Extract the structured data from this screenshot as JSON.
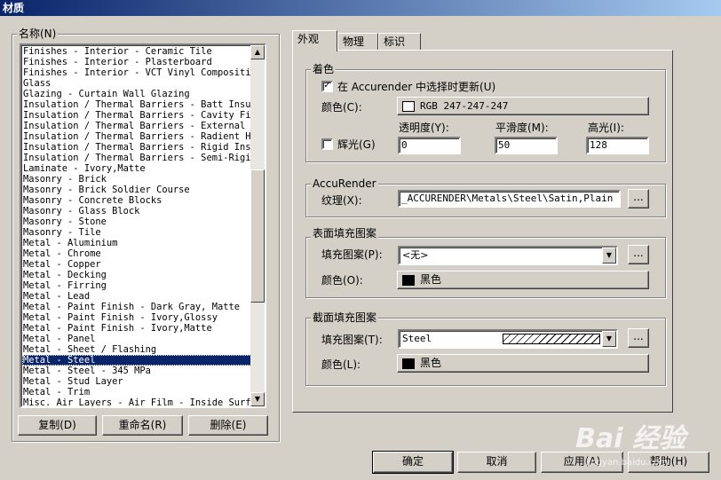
{
  "window": {
    "title": "材质"
  },
  "names_group": {
    "label": "名称(N)"
  },
  "materials": [
    "Finishes - Interior - Ceramic Tile",
    "Finishes - Interior - Plasterboard",
    "Finishes - Interior - VCT Vinyl Composition",
    "Glass",
    "Glazing - Curtain Wall Glazing",
    "Insulation / Thermal Barriers - Batt Insula",
    "Insulation / Thermal Barriers - Cavity Fill",
    "Insulation / Thermal Barriers - External Wa",
    "Insulation / Thermal Barriers - Radient Hea",
    "Insulation / Thermal Barriers - Rigid Insul",
    "Insulation / Thermal Barriers - Semi-Rigid I",
    "Laminate - Ivory,Matte",
    "Masonry - Brick",
    "Masonry - Brick Soldier Course",
    "Masonry - Concrete Blocks",
    "Masonry - Glass Block",
    "Masonry - Stone",
    "Masonry - Tile",
    "Metal - Aluminium",
    "Metal - Chrome",
    "Metal - Copper",
    "Metal - Decking",
    "Metal - Firring",
    "Metal - Lead",
    "Metal - Paint Finish - Dark Gray, Matte",
    "Metal - Paint Finish - Ivory,Glossy",
    "Metal - Paint Finish - Ivory,Matte",
    "Metal - Panel",
    "Metal - Sheet / Flashing",
    "Metal - Steel",
    "Metal - Steel - 345 MPa",
    "Metal - Stud Layer",
    "Metal - Trim",
    "Misc. Air Layers - Air Film - Inside Surfac"
  ],
  "selected_index": 29,
  "list_buttons": {
    "copy": "复制(D)",
    "rename": "重命名(R)",
    "delete": "删除(E)"
  },
  "tabs": [
    {
      "label": "外观"
    },
    {
      "label": "物理"
    },
    {
      "label": "标识"
    }
  ],
  "shading": {
    "group_label": "着色",
    "accurender_update_label": "在 Accurender 中选择时更新(U)",
    "accurender_update_checked": true,
    "color_label": "颜色(C):",
    "color_value": "RGB 247-247-247",
    "color_hex": "#f7f7f7",
    "glow_label": "辉光(G)",
    "glow_checked": false,
    "transparency_label": "透明度(Y):",
    "transparency_value": "0",
    "smoothness_label": "平滑度(M):",
    "smoothness_value": "50",
    "highlight_label": "高光(I):",
    "highlight_value": "128"
  },
  "accurender": {
    "group_label": "AccuRender",
    "texture_label": "纹理(X):",
    "texture_value": "_ACCURENDER\\Metals\\Steel\\Satin,Plain",
    "browse_label": "..."
  },
  "surface_pattern": {
    "group_label": "表面填充图案",
    "fill_label": "填充图案(P):",
    "fill_value": "<无>",
    "color_label": "颜色(O):",
    "color_value": "黑色",
    "color_hex": "#000000",
    "browse_label": "..."
  },
  "cut_pattern": {
    "group_label": "截面填充图案",
    "fill_label": "填充图案(T):",
    "fill_value": "Steel",
    "color_label": "颜色(L):",
    "color_value": "黑色",
    "color_hex": "#000000",
    "browse_label": "..."
  },
  "footer": {
    "ok": "确定",
    "cancel": "取消",
    "apply": "应用(A)",
    "help": "帮助(H)"
  },
  "watermark": {
    "text": "Bai 经验",
    "sub": "jingyan.baidu.com"
  }
}
